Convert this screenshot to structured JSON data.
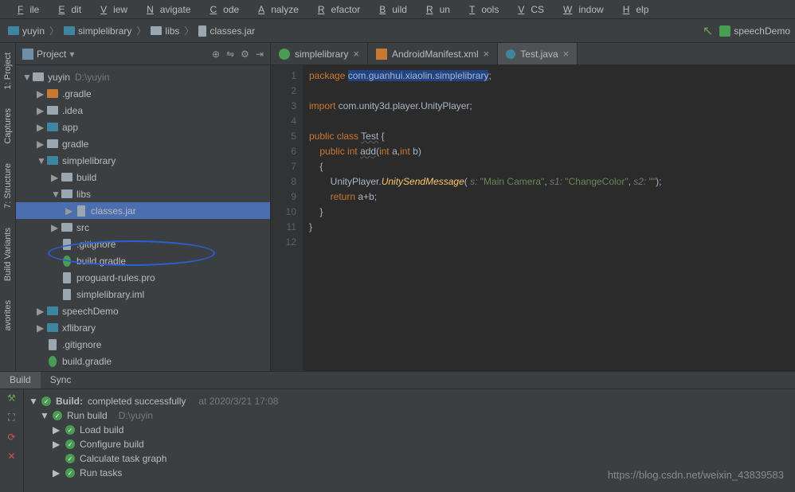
{
  "menu": [
    "File",
    "Edit",
    "View",
    "Navigate",
    "Code",
    "Analyze",
    "Refactor",
    "Build",
    "Run",
    "Tools",
    "VCS",
    "Window",
    "Help"
  ],
  "breadcrumb": {
    "items": [
      "yuyin",
      "simplelibrary",
      "libs",
      "classes.jar"
    ],
    "right_config": "speechDemo"
  },
  "project_panel": {
    "title": "Project",
    "root": {
      "name": "yuyin",
      "path": "D:\\yuyin"
    },
    "tree": [
      {
        "indent": 0,
        "arrow": "▼",
        "icon": "folder",
        "label": "yuyin",
        "muted": "D:\\yuyin"
      },
      {
        "indent": 1,
        "arrow": "▶",
        "icon": "folder-orange",
        "label": ".gradle"
      },
      {
        "indent": 1,
        "arrow": "▶",
        "icon": "folder",
        "label": ".idea"
      },
      {
        "indent": 1,
        "arrow": "▶",
        "icon": "folder-teal",
        "label": "app"
      },
      {
        "indent": 1,
        "arrow": "▶",
        "icon": "folder",
        "label": "gradle"
      },
      {
        "indent": 1,
        "arrow": "▼",
        "icon": "folder-teal",
        "label": "simplelibrary"
      },
      {
        "indent": 2,
        "arrow": "▶",
        "icon": "folder",
        "label": "build"
      },
      {
        "indent": 2,
        "arrow": "▼",
        "icon": "folder",
        "label": "libs"
      },
      {
        "indent": 3,
        "arrow": "▶",
        "icon": "jar",
        "label": "classes.jar",
        "selected": true
      },
      {
        "indent": 2,
        "arrow": "▶",
        "icon": "folder",
        "label": "src"
      },
      {
        "indent": 2,
        "arrow": "",
        "icon": "file",
        "label": ".gitignore"
      },
      {
        "indent": 2,
        "arrow": "",
        "icon": "gradle",
        "label": "build.gradle"
      },
      {
        "indent": 2,
        "arrow": "",
        "icon": "file",
        "label": "proguard-rules.pro"
      },
      {
        "indent": 2,
        "arrow": "",
        "icon": "file",
        "label": "simplelibrary.iml"
      },
      {
        "indent": 1,
        "arrow": "▶",
        "icon": "folder-teal",
        "label": "speechDemo"
      },
      {
        "indent": 1,
        "arrow": "▶",
        "icon": "folder-teal",
        "label": "xflibrary"
      },
      {
        "indent": 1,
        "arrow": "",
        "icon": "file",
        "label": ".gitignore"
      },
      {
        "indent": 1,
        "arrow": "",
        "icon": "gradle",
        "label": "build.gradle"
      }
    ]
  },
  "sidetabs": {
    "project": "1: Project",
    "captures": "Captures",
    "structure": "7: Structure",
    "buildvar": "Build Variants",
    "fav": "avorites"
  },
  "editor_tabs": [
    {
      "label": "simplelibrary",
      "icon": "gradle",
      "active": false
    },
    {
      "label": "AndroidManifest.xml",
      "icon": "xml",
      "active": false
    },
    {
      "label": "Test.java",
      "icon": "java",
      "active": true
    }
  ],
  "code": {
    "lines": [
      {
        "n": 1,
        "html": "<span class='kw'>package</span> <span class='pkg'>com.guanhui.xiaolin.simplelibrary</span>;"
      },
      {
        "n": 2,
        "html": ""
      },
      {
        "n": 3,
        "html": "<span class='kw'>import</span> com.unity3d.player.UnityPlayer;"
      },
      {
        "n": 4,
        "html": ""
      },
      {
        "n": 5,
        "html": "<span class='kw'>public class</span> <span class='underline'>Test</span> {"
      },
      {
        "n": 6,
        "html": "    <span class='kw'>public int</span> <span class='underline'>add</span>(<span class='kw'>int</span> a,<span class='kw'>int</span> b)"
      },
      {
        "n": 7,
        "html": "    {"
      },
      {
        "n": 8,
        "html": "        UnityPlayer.<span class='method'>UnitySendMessage</span>( <span class='hint'>s:</span> <span class='str'>\"Main Camera\"</span>, <span class='hint'>s1:</span> <span class='str'>\"ChangeColor\"</span>, <span class='hint'>s2:</span> <span class='str'>\"\"</span>);"
      },
      {
        "n": 9,
        "html": "        <span class='kw'>return</span> a+b;"
      },
      {
        "n": 10,
        "html": "    }"
      },
      {
        "n": 11,
        "html": "}"
      },
      {
        "n": 12,
        "html": ""
      }
    ]
  },
  "bottom": {
    "tabs": [
      "Build",
      "Sync"
    ],
    "active_tab": 0,
    "build_title": "Build:",
    "build_status": "completed successfully",
    "build_time": "at 2020/3/21 17:08",
    "rows": [
      {
        "indent": 0,
        "arrow": "▼",
        "label": "Run build",
        "muted": "D:\\yuyin"
      },
      {
        "indent": 1,
        "arrow": "▶",
        "label": "Load build"
      },
      {
        "indent": 1,
        "arrow": "▶",
        "label": "Configure build"
      },
      {
        "indent": 1,
        "arrow": "",
        "label": "Calculate task graph"
      },
      {
        "indent": 1,
        "arrow": "▶",
        "label": "Run tasks"
      }
    ]
  },
  "watermark": "https://blog.csdn.net/weixin_43839583"
}
